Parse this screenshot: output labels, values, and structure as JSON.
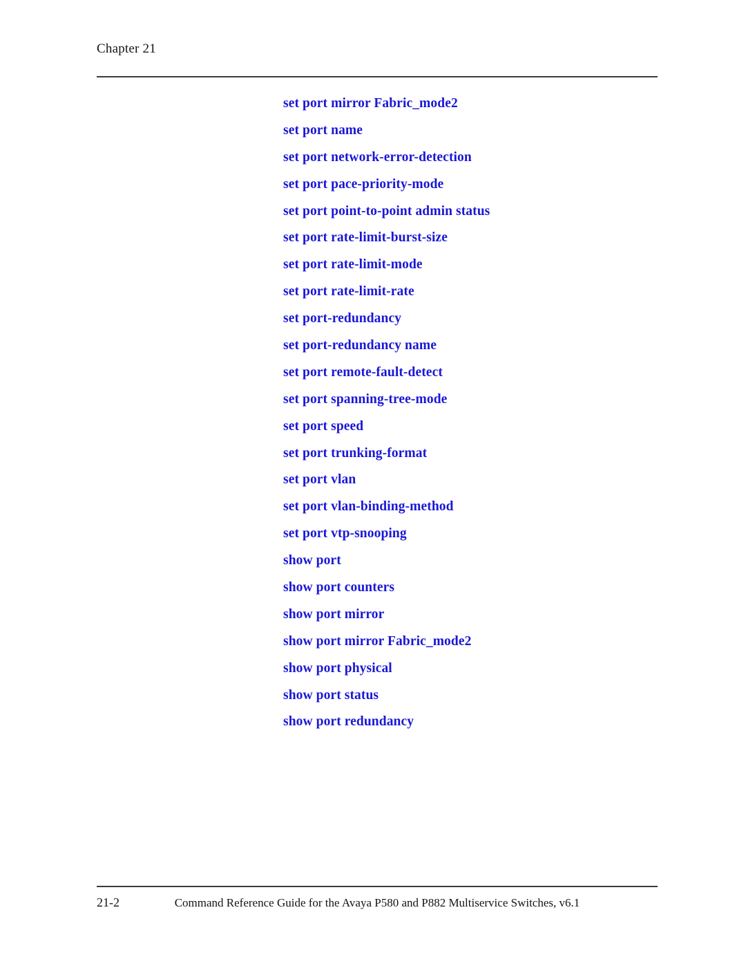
{
  "header": {
    "chapter_label": "Chapter  21"
  },
  "toc": {
    "items": [
      {
        "label": "set port mirror Fabric_mode2"
      },
      {
        "label": "set port name"
      },
      {
        "label": "set port network-error-detection"
      },
      {
        "label": "set port pace-priority-mode"
      },
      {
        "label": "set port point-to-point admin status"
      },
      {
        "label": "set port rate-limit-burst-size"
      },
      {
        "label": "set port rate-limit-mode"
      },
      {
        "label": "set port rate-limit-rate"
      },
      {
        "label": "set port-redundancy"
      },
      {
        "label": "set port-redundancy name"
      },
      {
        "label": "set port remote-fault-detect"
      },
      {
        "label": "set port spanning-tree-mode"
      },
      {
        "label": "set port speed"
      },
      {
        "label": "set port trunking-format"
      },
      {
        "label": "set port vlan"
      },
      {
        "label": "set port vlan-binding-method"
      },
      {
        "label": "set port vtp-snooping"
      },
      {
        "label": "show port"
      },
      {
        "label": "show port counters"
      },
      {
        "label": "show port mirror"
      },
      {
        "label": "show port mirror Fabric_mode2"
      },
      {
        "label": "show port physical"
      },
      {
        "label": "show port status"
      },
      {
        "label": "show port redundancy"
      }
    ]
  },
  "footer": {
    "page_number": "21-2",
    "guide_title": "Command Reference Guide for the Avaya P580 and P882 Multiservice Switches, v6.1"
  },
  "colors": {
    "link_blue": "#1a17d6",
    "body_text": "#141414",
    "rule": "#3a3a3a",
    "background": "#ffffff"
  }
}
